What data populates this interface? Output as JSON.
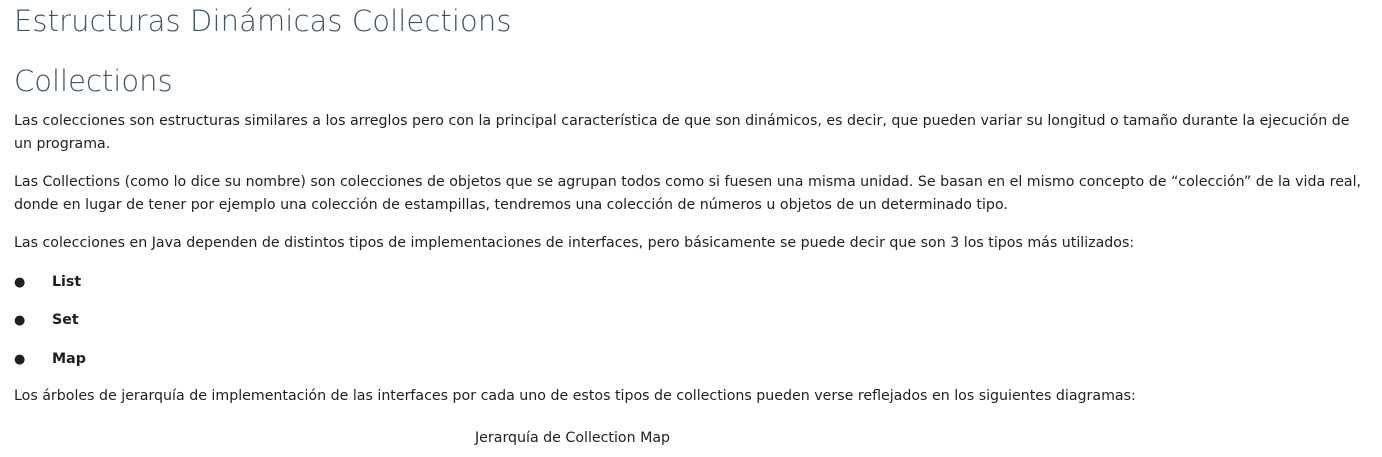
{
  "page_title": "Estructuras Dinámicas Collections",
  "section_title": "Collections",
  "paragraphs": [
    "Las colecciones son estructuras similares a los arreglos pero con la principal característica de que son dinámicos, es decir, que pueden variar su longitud o tamaño durante la ejecución de un programa.",
    "Las Collections (como lo dice su nombre) son colecciones de objetos que se agrupan todos como si fuesen una misma unidad. Se basan en el mismo concepto de “colección” de la vida real, donde en lugar de tener por ejemplo una colección de estampillas, tendremos una colección de números u objetos de un determinado tipo.",
    "Las colecciones en Java dependen de distintos tipos de implementaciones de interfaces, pero básicamente se puede decir que son 3 los tipos más utilizados:",
    "Los árboles de jerarquía de implementación de las interfaces por cada uno de estos tipos de collections pueden verse reflejados en los siguientes diagramas:"
  ],
  "list": {
    "bullet": "●",
    "items": [
      "List",
      "Set",
      "Map"
    ]
  },
  "caption": "Jerarquía de Collection Map"
}
